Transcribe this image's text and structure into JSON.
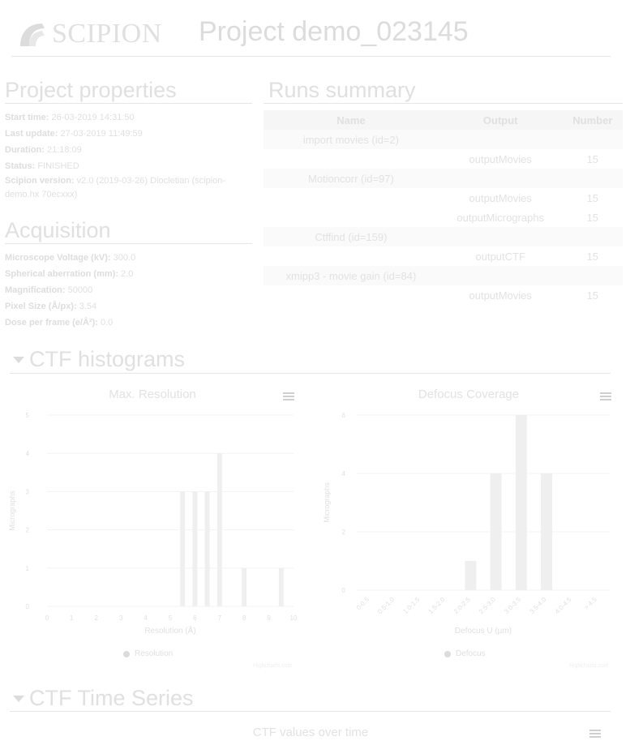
{
  "header": {
    "logo_text": "SCIPION",
    "project_title": "Project demo_023145"
  },
  "properties": {
    "title": "Project properties",
    "items": [
      {
        "label": "Start time:",
        "value": "26-03-2019 14:31:50"
      },
      {
        "label": "Last update:",
        "value": "27-03-2019 11:49:59"
      },
      {
        "label": "Duration:",
        "value": "21:18:09"
      },
      {
        "label": "Status:",
        "value": "FINISHED"
      },
      {
        "label": "Scipion version:",
        "value": "v2.0 (2019-03-26) Diocletian (scipion-demo.hx 70ecxxx)"
      }
    ]
  },
  "acquisition": {
    "title": "Acquisition",
    "items": [
      {
        "label": "Microscope Voltage (kV):",
        "value": "300.0"
      },
      {
        "label": "Spherical aberration (mm):",
        "value": "2.0"
      },
      {
        "label": "Magnification:",
        "value": "50000"
      },
      {
        "label": "Pixel Size (Å/px):",
        "value": "3.54"
      },
      {
        "label": "Dose per frame (e/Å²):",
        "value": "0.0"
      }
    ]
  },
  "runs": {
    "title": "Runs summary",
    "headers": [
      "Name",
      "Output",
      "Number"
    ],
    "rows": [
      {
        "type": "protocol",
        "name": "import movies (id=2)",
        "output": "",
        "number": ""
      },
      {
        "type": "output",
        "name": "",
        "output": "outputMovies",
        "number": "15"
      },
      {
        "type": "protocol",
        "name": "Motioncorr (id=97)",
        "output": "",
        "number": ""
      },
      {
        "type": "output",
        "name": "",
        "output": "outputMovies",
        "number": "15"
      },
      {
        "type": "output",
        "name": "",
        "output": "outputMicrographs",
        "number": "15"
      },
      {
        "type": "protocol",
        "name": "Ctffind (id=159)",
        "output": "",
        "number": ""
      },
      {
        "type": "output",
        "name": "",
        "output": "outputCTF",
        "number": "15"
      },
      {
        "type": "protocol",
        "name": "xmipp3 - movie gain (id=84)",
        "output": "",
        "number": ""
      },
      {
        "type": "output",
        "name": "",
        "output": "outputMovies",
        "number": "15"
      }
    ]
  },
  "ctf_histograms": {
    "title": "CTF histograms"
  },
  "ctf_time_series": {
    "title": "CTF Time Series",
    "chart_title": "CTF values over time"
  },
  "credits": "Highcharts.com",
  "colors": {
    "bar": "#efefef",
    "text": "#e0e0e0",
    "grid": "#f3f3f3"
  },
  "icons": [
    "scipion-logo-icon",
    "collapse-triangle-icon",
    "chart-menu-icon",
    "legend-dot-icon"
  ],
  "chart_data": [
    {
      "type": "bar",
      "title": "Max. Resolution",
      "xlabel": "Resolution (Å)",
      "ylabel": "Micrographs",
      "series_name": "Resolution",
      "x_ticks": [
        "0",
        "1",
        "2",
        "3",
        "4",
        "5",
        "6",
        "7",
        "8",
        "9",
        "10"
      ],
      "y_ticks": [
        "0",
        "1",
        "2",
        "3",
        "4",
        "5"
      ],
      "ylim": [
        0,
        5
      ],
      "bars": [
        {
          "x": 5.5,
          "value": 3
        },
        {
          "x": 6.0,
          "value": 3
        },
        {
          "x": 6.5,
          "value": 3
        },
        {
          "x": 7.0,
          "value": 4
        },
        {
          "x": 8.0,
          "value": 1
        },
        {
          "x": 9.5,
          "value": 1
        }
      ]
    },
    {
      "type": "bar",
      "title": "Defocus Coverage",
      "xlabel": "Defocus U (µm)",
      "ylabel": "Micrographs",
      "series_name": "Defocus",
      "categories": [
        "0-0.5",
        "0.5-1.0",
        "1.0-1.5",
        "1.5-2.0",
        "2.0-2.5",
        "2.5-3.0",
        "3.0-3.5",
        "3.5-4.0",
        "4.0-4.5",
        "> 4.5"
      ],
      "values": [
        0,
        0,
        0,
        0,
        1,
        4,
        6,
        4,
        0,
        0
      ],
      "y_ticks": [
        "0",
        "2",
        "4",
        "6"
      ],
      "ylim": [
        0,
        6
      ]
    }
  ]
}
